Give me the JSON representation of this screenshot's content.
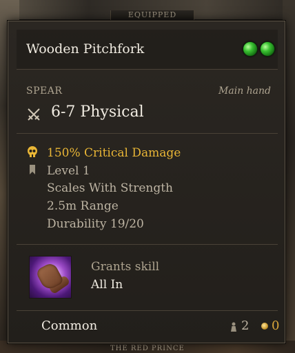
{
  "header": {
    "tab_label": "EQUIPPED"
  },
  "item": {
    "name": "Wooden Pitchfork",
    "gems": [
      "green",
      "green"
    ],
    "type": "SPEAR",
    "hand": "Main hand",
    "damage": "6-7 Physical",
    "stats": [
      {
        "icon": "skull-icon",
        "text": "150% Critical Damage",
        "highlight": true
      },
      {
        "icon": "bookmark-icon",
        "text": "Level 1"
      },
      {
        "icon": "",
        "text": "Scales With Strength"
      },
      {
        "icon": "",
        "text": "2.5m Range"
      },
      {
        "icon": "",
        "text": "Durability 19/20"
      }
    ],
    "skill": {
      "grant_label": "Grants skill",
      "name": "All In"
    },
    "footer": {
      "rarity": "Common",
      "weight": "2",
      "value": "0"
    }
  },
  "background": {
    "name_plate": "THE RED PRINCE"
  },
  "colors": {
    "crit": "#e9b636",
    "gold": "#d7a53a",
    "gem": "#39c031"
  }
}
